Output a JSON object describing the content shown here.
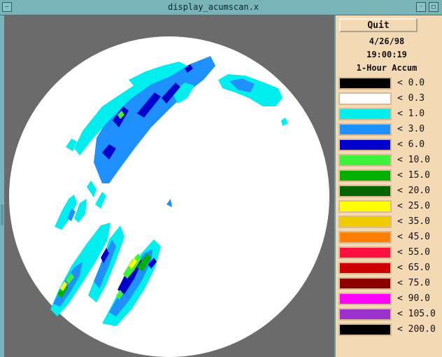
{
  "window": {
    "title": "display_acumscan.x",
    "controls": [
      "window-menu",
      "minimize",
      "maximize"
    ]
  },
  "panel": {
    "quit_label": "Quit",
    "date": "4/26/98",
    "time": "19:00:19",
    "product": "1-Hour Accum"
  },
  "legend": [
    {
      "label": "< 0.0",
      "color": "#000000"
    },
    {
      "label": "< 0.3",
      "color": "#ffffff"
    },
    {
      "label": "< 1.0",
      "color": "#00eeee"
    },
    {
      "label": "< 3.0",
      "color": "#1e90ff"
    },
    {
      "label": "< 6.0",
      "color": "#0000cd"
    },
    {
      "label": "< 10.0",
      "color": "#3cf23c"
    },
    {
      "label": "< 15.0",
      "color": "#00b000"
    },
    {
      "label": "< 20.0",
      "color": "#006400"
    },
    {
      "label": "< 25.0",
      "color": "#ffff00"
    },
    {
      "label": "< 35.0",
      "color": "#eecc00"
    },
    {
      "label": "< 45.0",
      "color": "#ff7f00"
    },
    {
      "label": "< 55.0",
      "color": "#ff1040"
    },
    {
      "label": "< 65.0",
      "color": "#cc0000"
    },
    {
      "label": "< 75.0",
      "color": "#8b0000"
    },
    {
      "label": "< 90.0",
      "color": "#ff00ff"
    },
    {
      "label": "< 105.0",
      "color": "#9932cc"
    },
    {
      "label": "< 200.0",
      "color": "#000000"
    }
  ]
}
